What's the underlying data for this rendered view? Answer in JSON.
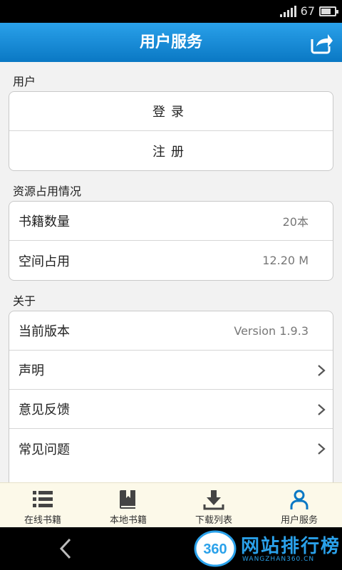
{
  "status_bar": {
    "battery_text": "67",
    "battery_level": 0.67
  },
  "header": {
    "title": "用户服务",
    "share_icon": "share-icon"
  },
  "sections": {
    "user": {
      "title": "用户",
      "login_label": "登录",
      "register_label": "注册"
    },
    "resources": {
      "title": "资源占用情况",
      "books_label": "书籍数量",
      "books_value": "20本",
      "space_label": "空间占用",
      "space_value": "12.20 M"
    },
    "about": {
      "title": "关于",
      "version_label": "当前版本",
      "version_value": "Version 1.9.3",
      "statement_label": "声明",
      "feedback_label": "意见反馈",
      "faq_label": "常见问题"
    }
  },
  "tabs": [
    {
      "label": "在线书籍",
      "icon": "list-icon"
    },
    {
      "label": "本地书籍",
      "icon": "book-icon"
    },
    {
      "label": "下载列表",
      "icon": "download-icon"
    },
    {
      "label": "用户服务",
      "icon": "user-icon"
    }
  ],
  "watermark": {
    "logo_text": "360",
    "title": "网站排行榜",
    "subtitle": "WANGZHAN360.CN"
  },
  "colors": {
    "header_blue": "#0a78c4",
    "accent": "#2aa1ea"
  }
}
